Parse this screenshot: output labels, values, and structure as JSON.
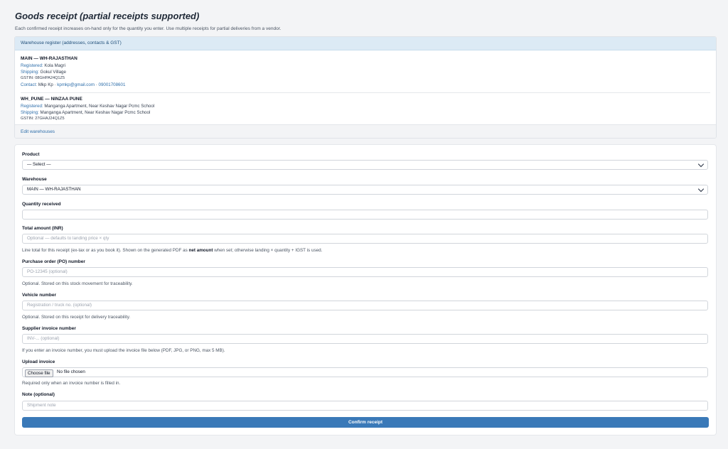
{
  "page": {
    "title": "Goods receipt (partial receipts supported)",
    "subtitle": "Each confirmed receipt increases on-hand only for the quantity you enter. Use multiple receipts for partial deliveries from a vendor."
  },
  "warehouses": {
    "header": "Warehouse register (addresses, contacts & GST)",
    "edit_link": "Edit warehouses",
    "items": [
      {
        "name": "MAIN — WH-RAJASTHAN",
        "registered_label": "Registered:",
        "registered": "Kola Magri",
        "shipping_label": "Shipping:",
        "shipping": "Gokul Village",
        "gstin": "GSTIN: 08GHPA24Q1Z5",
        "contact_label": "Contact:",
        "contact_name": "Mkp Kp",
        "contact_sep": "·",
        "contact_email": "kpmkp@gmail.com",
        "contact_phone": "09001708601"
      },
      {
        "name": "WH_PUNE — NINZAA PUNE",
        "registered_label": "Registered:",
        "registered": "Manganga Apartment, Near Keshav Nagar Pcmc School",
        "shipping_label": "Shipping:",
        "shipping": "Manganga Apartment, Near Keshav Nagar Pcmc School",
        "gstin": "GSTIN: 27GHAJ24Q1Z5"
      }
    ]
  },
  "form": {
    "product": {
      "label": "Product",
      "value": "— Select —"
    },
    "warehouse": {
      "label": "Warehouse",
      "value": "MAIN — WH-RAJASTHAN"
    },
    "quantity": {
      "label": "Quantity received",
      "value": "",
      "placeholder": ""
    },
    "total": {
      "label": "Total amount (INR)",
      "placeholder": "Optional — defaults to landing price × qty",
      "help_pre": "Line total for this receipt (ex-tax or as you book it). Shown on the generated PDF as",
      "help_bold": "net amount",
      "help_post": "when set; otherwise landing × quantity + IGST is used."
    },
    "po": {
      "label": "Purchase order (PO) number",
      "placeholder": "PO-12345 (optional)",
      "help": "Optional. Stored on this stock movement for traceability."
    },
    "vehicle": {
      "label": "Vehicle number",
      "placeholder": "Registration / truck no. (optional)",
      "help": "Optional. Stored on this receipt for delivery traceability."
    },
    "invoice": {
      "label": "Supplier invoice number",
      "placeholder": "INV-... (optional)",
      "help": "If you enter an invoice number, you must upload the invoice file below (PDF, JPG, or PNG, max 5 MB)."
    },
    "upload": {
      "label": "Upload invoice",
      "button": "Choose file",
      "status": "No file chosen",
      "help": "Required only when an invoice number is filled in."
    },
    "note": {
      "label": "Note (optional)",
      "placeholder": "Shipment note"
    },
    "submit": "Confirm receipt"
  }
}
